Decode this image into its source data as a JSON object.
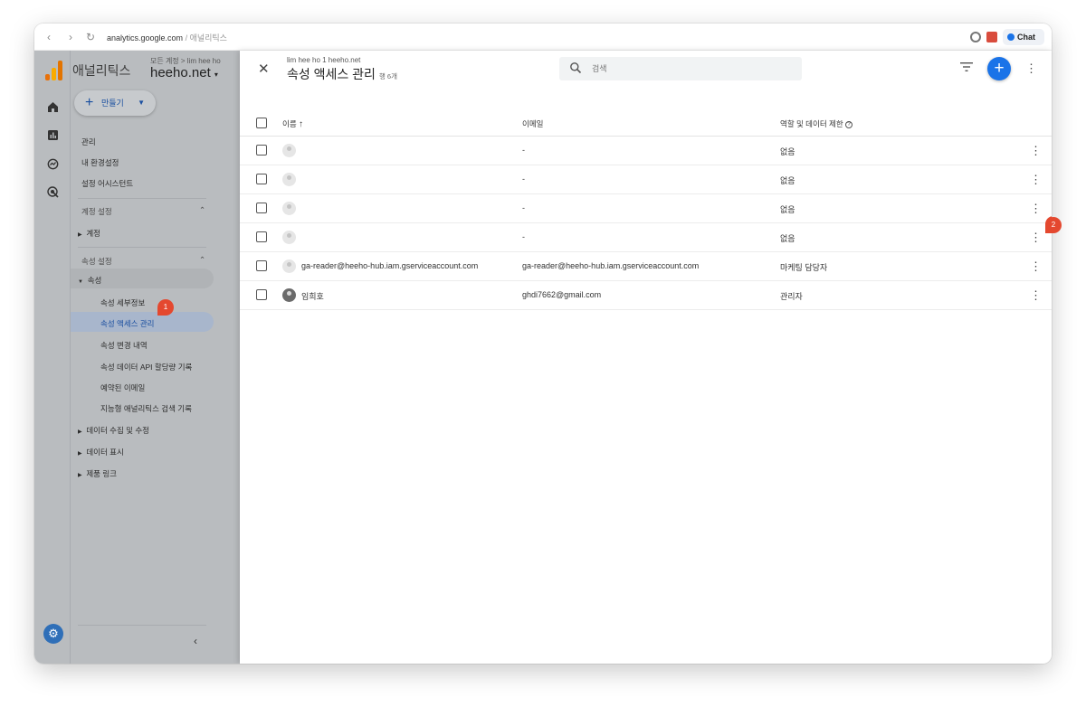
{
  "browser": {
    "url_domain": "analytics.google.com",
    "url_crumb": "/ 애널리틱스",
    "chat_label": "Chat"
  },
  "app": {
    "name": "애널리틱스",
    "account_crumb": "모든 계정 > lim hee ho",
    "property_name": "heeho.net"
  },
  "sidebar": {
    "create_label": "만들기",
    "top_items": [
      "관리",
      "내 환경설정",
      "설정 어시스턴트"
    ],
    "account_section": "계정 설정",
    "account_item": "계정",
    "property_section": "속성 설정",
    "property_item": "속성",
    "property_sub": [
      "속성 세부정보",
      "속성 액세스 관리",
      "속성 변경 내역",
      "속성 데이터 API 할당량 기록",
      "예약된 이메일",
      "지능형 애널리틱스 검색 기록"
    ],
    "other_items": [
      "데이터 수집 및 수정",
      "데이터 표시",
      "제품 링크"
    ]
  },
  "panel": {
    "crumb": "lim hee ho 1 heeho.net",
    "title": "속성 액세스 관리",
    "count": "행 6개",
    "search_placeholder": "검색"
  },
  "table": {
    "headers": {
      "name": "이름",
      "email": "이메일",
      "role": "역할 및 데이터 제한"
    },
    "rows": [
      {
        "name": "",
        "email": "-",
        "role": "없음",
        "photo": false
      },
      {
        "name": "",
        "email": "-",
        "role": "없음",
        "photo": false
      },
      {
        "name": "",
        "email": "-",
        "role": "없음",
        "photo": false
      },
      {
        "name": "",
        "email": "-",
        "role": "없음",
        "photo": false
      },
      {
        "name": "ga-reader@heeho-hub.iam.gserviceaccount.com",
        "email": "ga-reader@heeho-hub.iam.gserviceaccount.com",
        "role": "마케팅 담당자",
        "photo": false
      },
      {
        "name": "임희호",
        "email": "ghdi7662@gmail.com",
        "role": "관리자",
        "photo": true
      }
    ]
  },
  "annotations": [
    "1",
    "2"
  ],
  "colors": {
    "accent": "#1a73e8",
    "badge": "#e4482f",
    "dim": "#b9bcbf"
  }
}
